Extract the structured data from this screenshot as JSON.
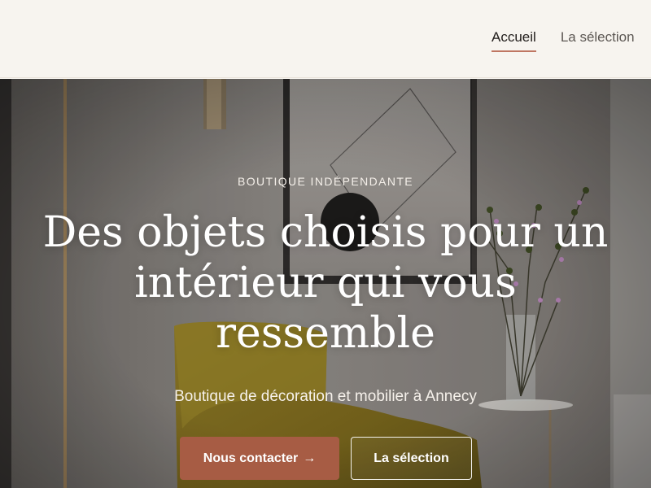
{
  "header": {
    "nav": [
      {
        "label": "Accueil",
        "active": true
      },
      {
        "label": "La sélection",
        "active": false
      }
    ]
  },
  "hero": {
    "eyebrow": "BOUTIQUE INDÉPENDANTE",
    "headline_lines": [
      "Des objets choisis pour un",
      "intérieur qui vous",
      "ressemble"
    ],
    "subtitle": "Boutique de décoration et mobilier à Annecy",
    "primary_cta": {
      "label": "Nous contacter",
      "icon": "arrow-right-icon",
      "icon_glyph": "→"
    },
    "secondary_cta": {
      "label": "La sélection"
    },
    "background_image": "interior-photo-yellow-armchair-artwork-vase"
  },
  "colors": {
    "page_background": "#f7f4ef",
    "accent": "#a75c44",
    "nav_active_underline": "#b55f49",
    "hero_text": "#ffffff"
  }
}
